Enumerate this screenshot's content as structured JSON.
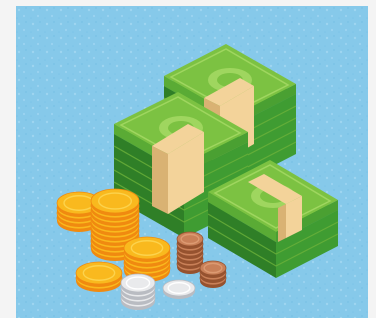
{
  "illustration": {
    "subject": "money-stacks",
    "palette": {
      "background": "#86c9ea",
      "background_speckle": "#a9dbf3",
      "bill_top": "#7cc242",
      "bill_side": "#3f9c32",
      "bill_edge": "#2f7f27",
      "bill_light": "#9fd65f",
      "band": "#f3d39a",
      "band_shade": "#d9b273",
      "gold_top": "#f9b91e",
      "gold_rim": "#f08a10",
      "silver_top": "#e9eaec",
      "silver_rim": "#b9bcc2",
      "copper_top": "#c98058",
      "copper_rim": "#96522f"
    }
  }
}
